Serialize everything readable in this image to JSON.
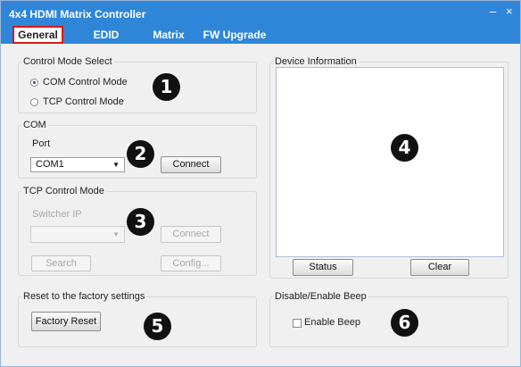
{
  "window": {
    "title": "4x4 HDMI Matrix Controller",
    "minimize": "–",
    "close": "×"
  },
  "tabs": [
    {
      "label": "General"
    },
    {
      "label": "EDID"
    },
    {
      "label": "Matrix"
    },
    {
      "label": "FW Upgrade"
    }
  ],
  "control_mode": {
    "title": "Control Mode Select",
    "options": [
      "COM Control Mode",
      "TCP Control Mode"
    ],
    "selected": "COM Control Mode"
  },
  "com": {
    "title": "COM",
    "port_label": "Port",
    "port_value": "COM1",
    "connect_label": "Connect"
  },
  "tcp": {
    "title": "TCP Control Mode",
    "ip_label": "Switcher IP",
    "ip_value": "",
    "connect_label": "Connect",
    "search_label": "Search",
    "config_label": "Config..."
  },
  "factory": {
    "title": "Reset to the factory settings",
    "button_label": "Factory Reset"
  },
  "device_info": {
    "title": "Device Information",
    "content": "",
    "status_label": "Status",
    "clear_label": "Clear"
  },
  "beep": {
    "title": "Disable/Enable Beep",
    "checkbox_label": "Enable Beep",
    "checked": false
  },
  "badges": [
    "1",
    "2",
    "3",
    "4",
    "5",
    "6"
  ],
  "colors": {
    "titlebar": "#2f86d8",
    "active_tab_border": "#d21b1b"
  }
}
